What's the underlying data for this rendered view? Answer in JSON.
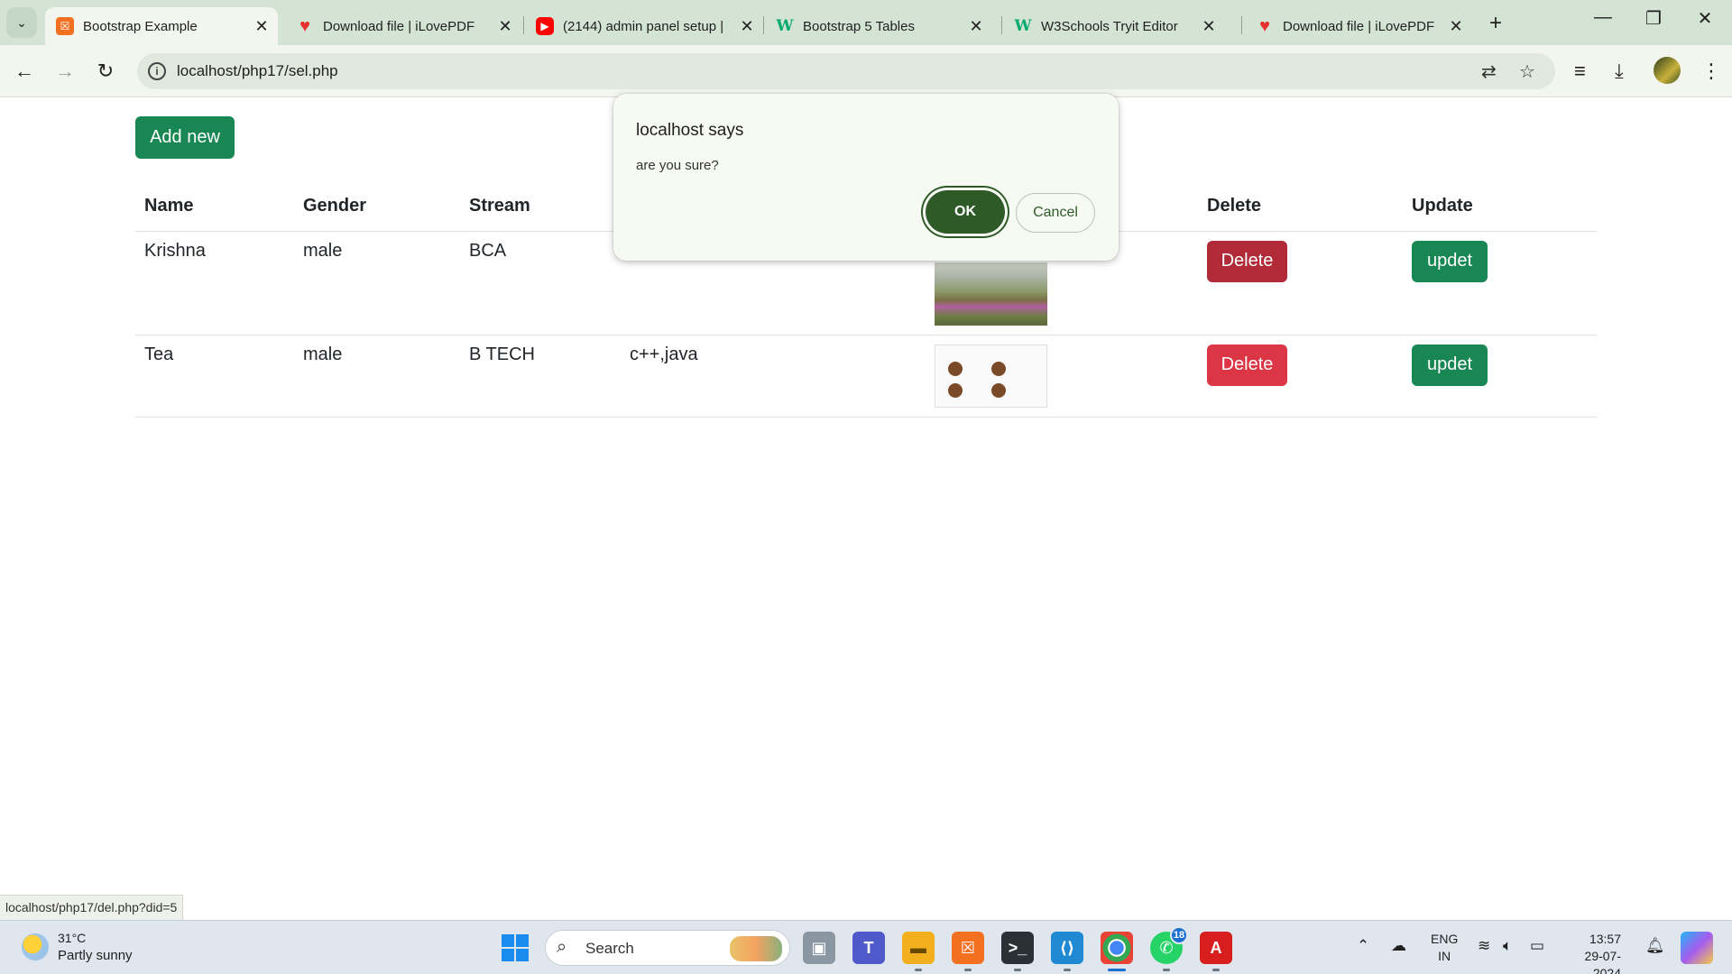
{
  "browser": {
    "tabs": [
      {
        "title": "Bootstrap Example",
        "favicon": "xampp-icon",
        "active": true
      },
      {
        "title": "Download file | iLovePDF",
        "favicon": "ilovepdf-icon",
        "active": false
      },
      {
        "title": "(2144) admin panel setup |",
        "favicon": "youtube-icon",
        "active": false
      },
      {
        "title": "Bootstrap 5 Tables",
        "favicon": "w3schools-icon",
        "active": false
      },
      {
        "title": "W3Schools Tryit Editor",
        "favicon": "w3schools-icon",
        "active": false
      },
      {
        "title": "Download file | iLovePDF",
        "favicon": "ilovepdf-icon",
        "active": false
      }
    ],
    "url": "localhost/php17/sel.php",
    "status_url": "localhost/php17/del.php?did=5"
  },
  "page": {
    "add_button": "Add new",
    "table": {
      "headers": [
        "Name",
        "Gender",
        "Stream",
        "",
        "",
        "Delete",
        "Update"
      ],
      "rows": [
        {
          "name": "Krishna",
          "gender": "male",
          "stream": "BCA",
          "subjects": "",
          "delete": "Delete",
          "update": "updet"
        },
        {
          "name": "Tea",
          "gender": "male",
          "stream": "B TECH",
          "subjects": "c++,java",
          "delete": "Delete",
          "update": "updet"
        }
      ]
    }
  },
  "dialog": {
    "title": "localhost says",
    "message": "are you sure?",
    "ok": "OK",
    "cancel": "Cancel"
  },
  "taskbar": {
    "weather_temp": "31°C",
    "weather_desc": "Partly sunny",
    "search_placeholder": "Search",
    "lang_line1": "ENG",
    "lang_line2": "IN",
    "time": "13:57",
    "date": "29-07-2024",
    "whatsapp_badge": "18"
  },
  "colors": {
    "success": "#198754",
    "danger": "#dc3545",
    "dialog_ok": "#2d5a27",
    "tabstrip": "#d3e3d4"
  }
}
